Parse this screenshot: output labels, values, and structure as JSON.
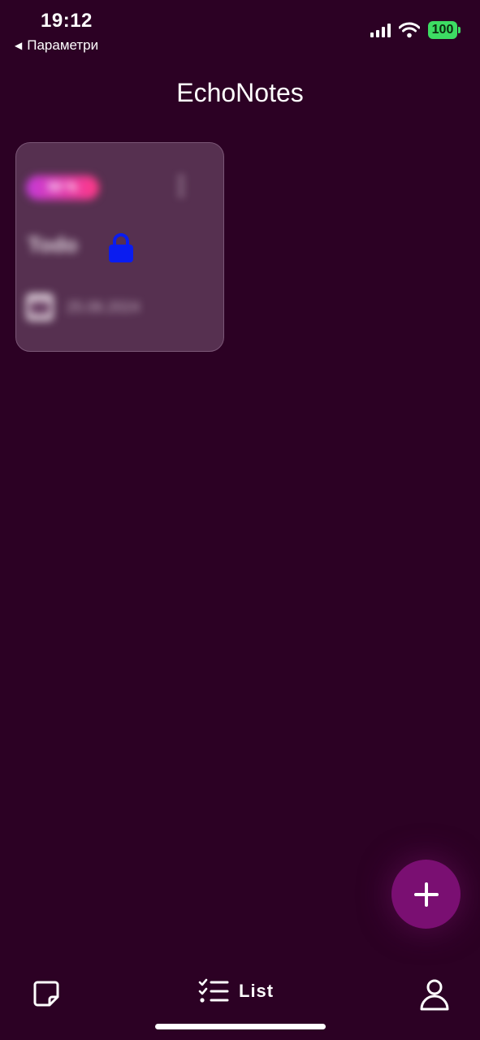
{
  "status_bar": {
    "time": "19:12",
    "back_label": "Параметри",
    "battery": "100",
    "battery_color": "#3ddc63"
  },
  "header": {
    "title": "EchoNotes"
  },
  "notes": [
    {
      "badge": "50 %",
      "title": "Todo",
      "locked": true,
      "date": "25.06.2024"
    }
  ],
  "fab": {
    "icon": "plus-icon"
  },
  "bottom_nav": {
    "notes_icon": "sticky-note-icon",
    "list_icon": "checklist-icon",
    "list_label": "List",
    "profile_icon": "user-icon"
  },
  "colors": {
    "background": "#2c0124",
    "card": "#563050",
    "fab": "#7a0f72",
    "lock": "#0a1cf0"
  }
}
